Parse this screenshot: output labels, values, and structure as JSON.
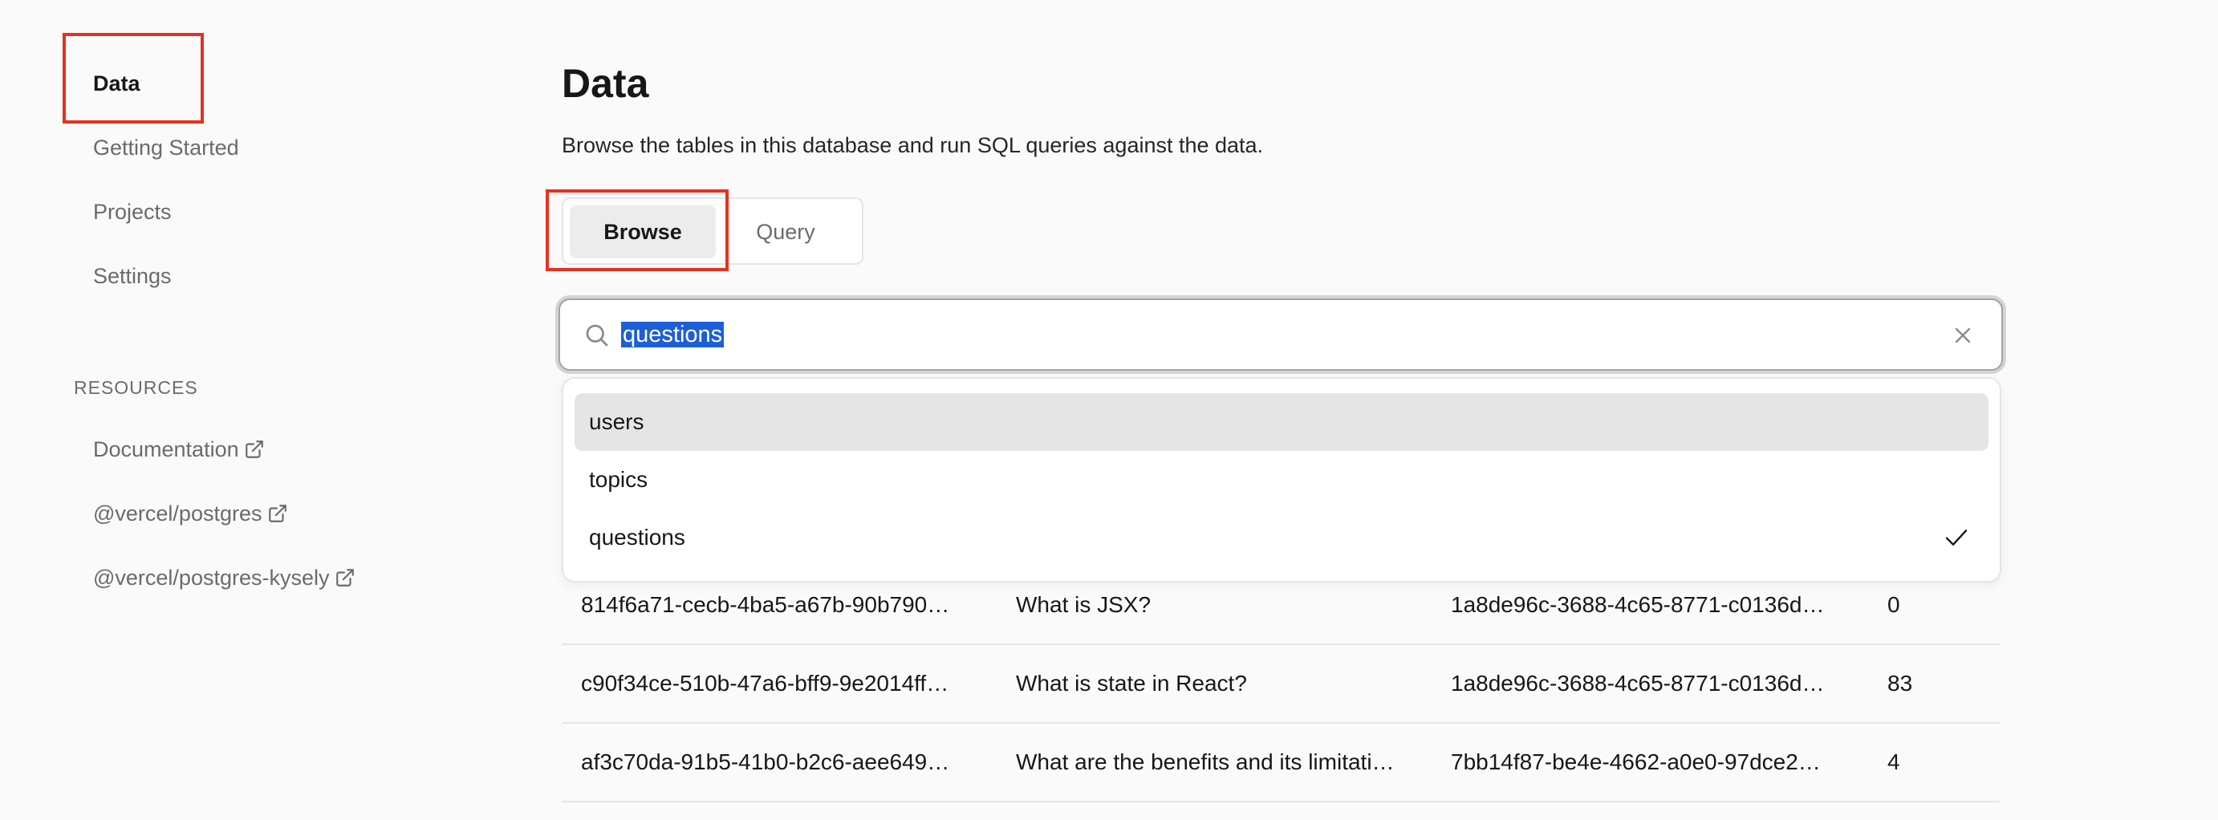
{
  "sidebar": {
    "nav": [
      "Data",
      "Getting Started",
      "Projects",
      "Settings"
    ],
    "resources_label": "RESOURCES",
    "resources": [
      "Documentation",
      "@vercel/postgres",
      "@vercel/postgres-kysely"
    ]
  },
  "main": {
    "title": "Data",
    "description": "Browse the tables in this database and run SQL queries against the data.",
    "tabs": [
      "Browse",
      "Query"
    ],
    "search": {
      "value": "questions"
    },
    "dropdown": {
      "options": [
        "users",
        "topics",
        "questions"
      ],
      "selected": "questions",
      "hovered": "users"
    },
    "table": {
      "rows": [
        [
          "814f6a71-cecb-4ba5-a67b-90b790…",
          "What is JSX?",
          "1a8de96c-3688-4c65-8771-c0136d…",
          "0"
        ],
        [
          "c90f34ce-510b-47a6-bff9-9e2014ff…",
          "What is state in React?",
          "1a8de96c-3688-4c65-8771-c0136d…",
          "83"
        ],
        [
          "af3c70da-91b5-41b0-b2c6-aee649…",
          "What are the benefits and its limitati…",
          "7bb14f87-be4e-4662-a0e0-97dce2…",
          "4"
        ]
      ]
    }
  },
  "colors": {
    "highlight": "#e5321e",
    "selection": "#1d5fd6"
  }
}
